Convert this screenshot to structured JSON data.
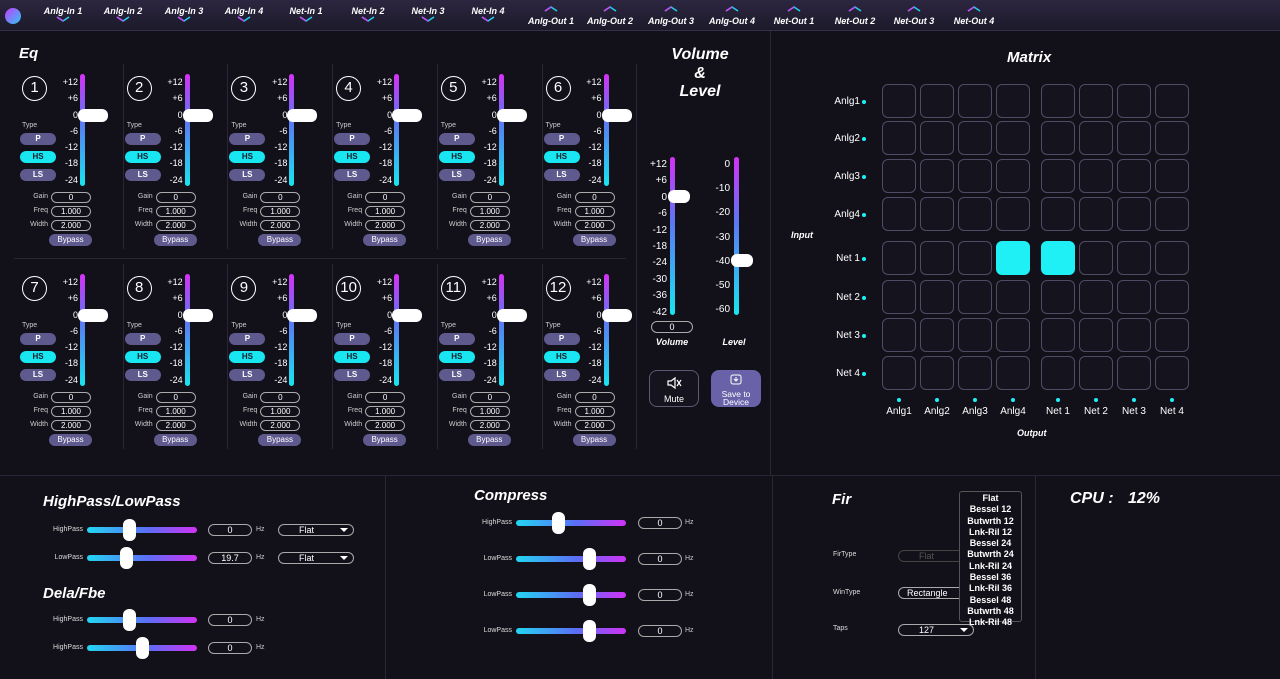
{
  "top_tabs_in": [
    "Anlg-In 1",
    "Anlg-In 2",
    "Anlg-In 3",
    "Anlg-In 4",
    "Net-In 1",
    "Net-In 2",
    "Net-In 3",
    "Net-In 4"
  ],
  "top_tabs_out": [
    "Anlg-Out 1",
    "Anlg-Out 2",
    "Anlg-Out 3",
    "Anlg-Out 4",
    "Net-Out 1",
    "Net-Out 2",
    "Net-Out 3",
    "Net-Out 4"
  ],
  "eq": {
    "title": "Eq",
    "scale": [
      "+12",
      "+6",
      "0",
      "-6",
      "-12",
      "-18",
      "-24"
    ],
    "type_label": "Type",
    "type_buttons": [
      "P",
      "HS",
      "LS"
    ],
    "selected_type": "HS",
    "gain_label": "Gain",
    "freq_label": "Freq",
    "width_label": "Width",
    "bypass_label": "Bypass",
    "channels": [
      {
        "num": "1",
        "gain": "0",
        "freq": "1.000",
        "width": "2.000"
      },
      {
        "num": "2",
        "gain": "0",
        "freq": "1.000",
        "width": "2.000"
      },
      {
        "num": "3",
        "gain": "0",
        "freq": "1.000",
        "width": "2.000"
      },
      {
        "num": "4",
        "gain": "0",
        "freq": "1.000",
        "width": "2.000"
      },
      {
        "num": "5",
        "gain": "0",
        "freq": "1.000",
        "width": "2.000"
      },
      {
        "num": "6",
        "gain": "0",
        "freq": "1.000",
        "width": "2.000"
      },
      {
        "num": "7",
        "gain": "0",
        "freq": "1.000",
        "width": "2.000"
      },
      {
        "num": "8",
        "gain": "0",
        "freq": "1.000",
        "width": "2.000"
      },
      {
        "num": "9",
        "gain": "0",
        "freq": "1.000",
        "width": "2.000"
      },
      {
        "num": "10",
        "gain": "0",
        "freq": "1.000",
        "width": "2.000"
      },
      {
        "num": "11",
        "gain": "0",
        "freq": "1.000",
        "width": "2.000"
      },
      {
        "num": "12",
        "gain": "0",
        "freq": "1.000",
        "width": "2.000"
      }
    ]
  },
  "volume_level": {
    "title_line1": "Volume",
    "title_line2": "&",
    "title_line3": "Level",
    "volume_scale": [
      "+12",
      "+6",
      "0",
      "-6",
      "-12",
      "-18",
      "-24",
      "-30",
      "-36",
      "-42"
    ],
    "level_scale": [
      "0",
      "-10",
      "-20",
      "-30",
      "-40",
      "-50",
      "-60"
    ],
    "volume_value": "0",
    "volume_label": "Volume",
    "level_label": "Level",
    "mute_label": "Mute",
    "save_label_1": "Save to",
    "save_label_2": "Device"
  },
  "matrix": {
    "title": "Matrix",
    "input_axis": "Input",
    "output_axis": "Output",
    "inputs": [
      "Anlg1",
      "Anlg2",
      "Anlg3",
      "Anlg4",
      "Net 1",
      "Net 2",
      "Net 3",
      "Net 4"
    ],
    "outputs": [
      "Anlg1",
      "Anlg2",
      "Anlg3",
      "Anlg4",
      "Net 1",
      "Net 2",
      "Net 3",
      "Net 4"
    ],
    "active": [
      [
        4,
        3
      ],
      [
        4,
        4
      ]
    ]
  },
  "hplp": {
    "title": "HighPass/LowPass",
    "rows": [
      {
        "label": "HighPass",
        "value": "0",
        "unit": "Hz",
        "filter": "Flat",
        "position": 0.38
      },
      {
        "label": "LowPass",
        "value": "19.7",
        "unit": "Hz",
        "filter": "Flat",
        "position": 0.35
      }
    ]
  },
  "dela": {
    "title": "Dela/Fbe",
    "rows": [
      {
        "label": "HighPass",
        "value": "0",
        "unit": "Hz",
        "position": 0.38
      },
      {
        "label": "HighPass",
        "value": "0",
        "unit": "Hz",
        "position": 0.5
      }
    ]
  },
  "compress": {
    "title": "Compress",
    "rows": [
      {
        "label": "HighPass",
        "value": "0",
        "unit": "Hz",
        "position": 0.38
      },
      {
        "label": "LowPass",
        "value": "0",
        "unit": "Hz",
        "position": 0.66
      },
      {
        "label": "LowPass",
        "value": "0",
        "unit": "Hz",
        "position": 0.66
      },
      {
        "label": "LowPass",
        "value": "0",
        "unit": "Hz",
        "position": 0.66
      }
    ]
  },
  "fir": {
    "title": "Fir",
    "firtype_label": "FirType",
    "firtype_value": "Flat",
    "wintype_label": "WinType",
    "wintype_value": "Rectangle",
    "taps_label": "Taps",
    "taps_value": "127",
    "menu_options": [
      "Flat",
      "Bessel 12",
      "Butwrth 12",
      "Lnk-Ril 12",
      "Bessel 24",
      "Butwrth 24",
      "Lnk-Ril 24",
      "Bessel 36",
      "Lnk-Ril 36",
      "Bessel 48",
      "Butwrth 48",
      "Lnk-Ril 48"
    ]
  },
  "cpu": {
    "label": "CPU :",
    "value": "12%"
  },
  "colors": {
    "accent_cyan": "#1ef0f5",
    "accent_purple": "#d232f6",
    "button_purple": "#5f5a8e"
  }
}
